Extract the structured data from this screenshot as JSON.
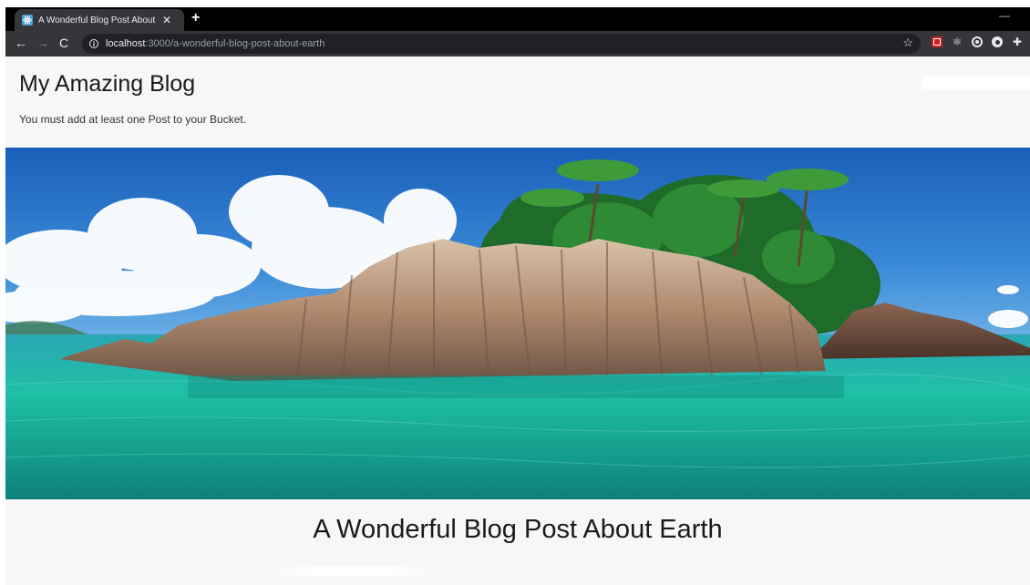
{
  "browser": {
    "tab_title": "A Wonderful Blog Post About Earth",
    "tab_close_icon": "close-icon",
    "new_tab_icon": "plus-icon",
    "url_host": "localhost",
    "url_rest": ":3000/a-wonderful-blog-post-about-earth",
    "icons": [
      "back-arrow-icon",
      "forward-arrow-icon",
      "reload-icon",
      "info-icon",
      "star-icon",
      "pdf-extension-icon",
      "react-extension-icon",
      "target-extension-icon",
      "record-extension-icon",
      "puzzle-extension-icon"
    ]
  },
  "site": {
    "title": "My Amazing Blog",
    "notice": "You must add at least one Post to your Bucket."
  },
  "post": {
    "title": "A Wonderful Blog Post About Earth"
  },
  "colors": {
    "chrome_dark": "#35363a",
    "tabbar": "#000000",
    "page_bg": "#f7f7f7",
    "sky": "#1e6fc4",
    "sea": "#1bb59c"
  }
}
